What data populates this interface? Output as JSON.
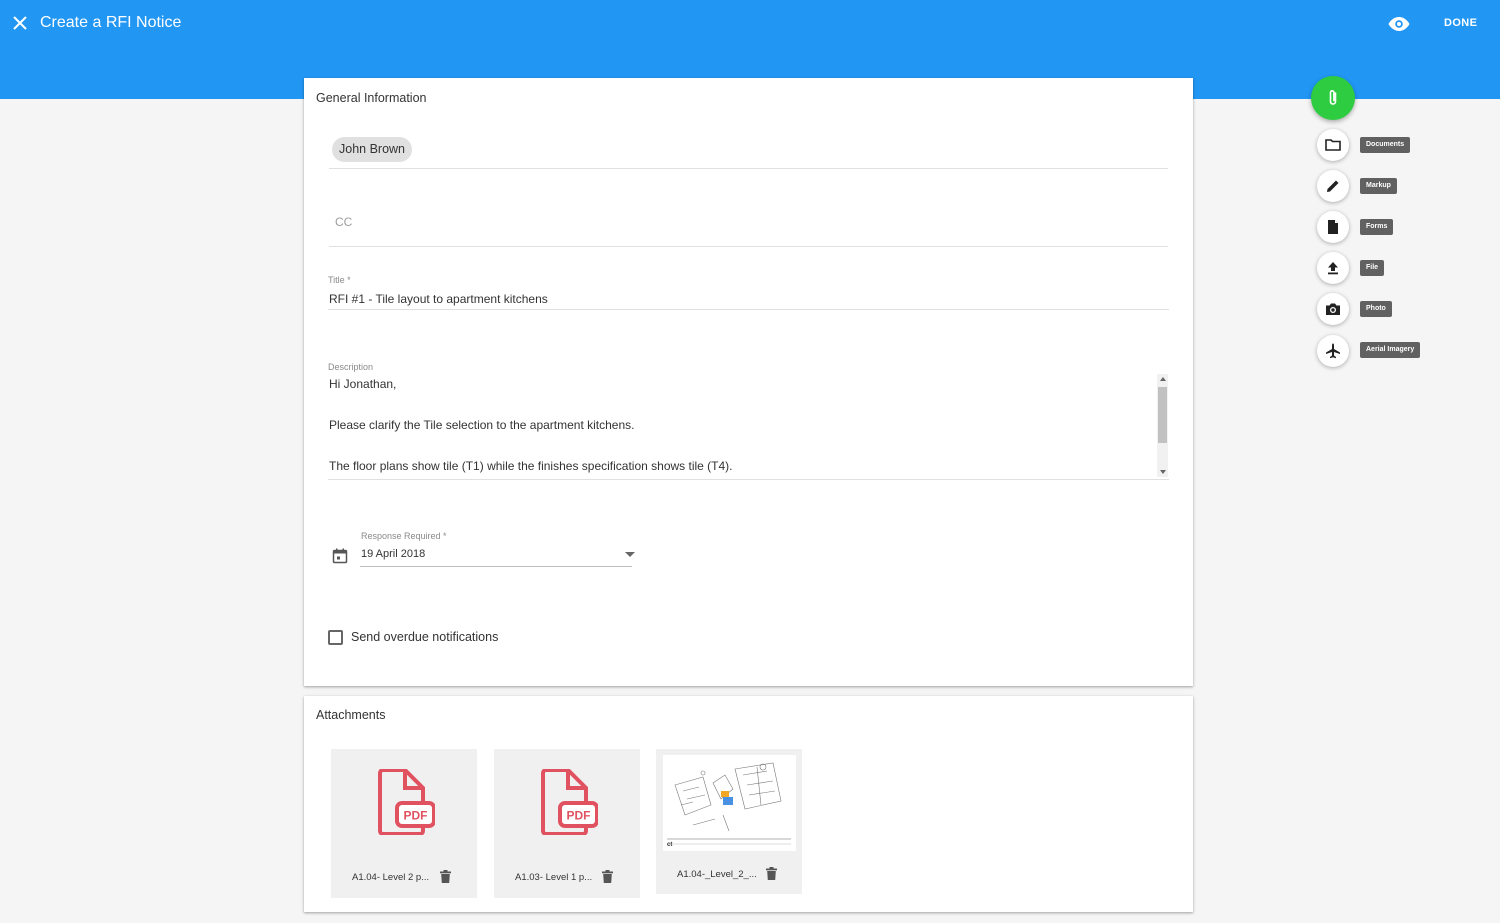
{
  "header": {
    "title": "Create a RFI Notice",
    "done_label": "DONE"
  },
  "general": {
    "section_title": "General Information",
    "recipient_chip": "John Brown",
    "cc_placeholder": "CC",
    "title_label": "Title *",
    "title_value": "RFI #1 - Tile layout to apartment kitchens",
    "description_label": "Description",
    "description_lines": [
      "Hi Jonathan,",
      "",
      "Please clarify the Tile selection to the apartment kitchens.",
      "",
      "The floor plans show tile (T1) while the finishes specification shows tile (T4)."
    ],
    "response_label": "Response Required *",
    "response_value": "19 April 2018",
    "overdue_label": "Send overdue notifications",
    "overdue_checked": false
  },
  "attachments": {
    "section_title": "Attachments",
    "items": [
      {
        "name": "A1.04- Level 2 p...",
        "type": "pdf"
      },
      {
        "name": "A1.03- Level 1 p...",
        "type": "pdf"
      },
      {
        "name": "A1.04-_Level_2_...",
        "type": "image"
      }
    ]
  },
  "speed_dial": {
    "main_icon": "paperclip-icon",
    "actions": [
      {
        "label": "Documents",
        "icon": "folder-icon"
      },
      {
        "label": "Markup",
        "icon": "pencil-icon"
      },
      {
        "label": "Forms",
        "icon": "document-icon"
      },
      {
        "label": "File",
        "icon": "upload-icon"
      },
      {
        "label": "Photo",
        "icon": "camera-icon"
      },
      {
        "label": "Aerial Imagery",
        "icon": "airplane-icon"
      }
    ]
  },
  "colors": {
    "primary": "#2196f3",
    "fab_green": "#2ecc40",
    "pdf_red": "#e05260"
  }
}
